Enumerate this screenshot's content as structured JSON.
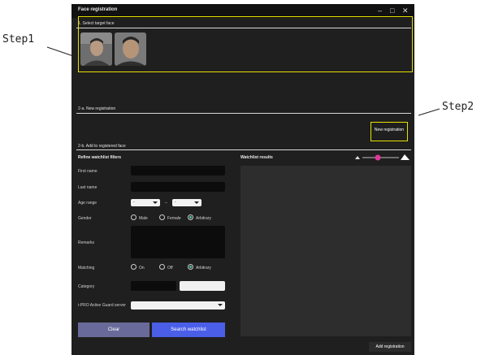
{
  "annotations": {
    "step1": "Step1",
    "step2": "Step2"
  },
  "window": {
    "title": "Face registration",
    "minimize": "–",
    "maximize": "□",
    "close": "✕"
  },
  "sections": {
    "select_target": "1. Select target face",
    "new_registration": "2-a. New registration",
    "add_registered": "2-b. Add to registered face"
  },
  "buttons": {
    "new_registration": "New registration",
    "clear": "Clear",
    "search": "Search watchlist",
    "add_registration": "Add registration"
  },
  "filters": {
    "title": "Refine watchlist filters",
    "first_name": "First name",
    "last_name": "Last name",
    "age_range": "Age range",
    "age_from": "-",
    "age_sep": "–",
    "age_to": "-",
    "gender": "Gender",
    "gender_options": [
      "Male",
      "Female",
      "Arbitrary"
    ],
    "gender_selected": "Arbitrary",
    "remarks": "Remarks",
    "matching": "Matching",
    "matching_options": [
      "On",
      "Off",
      "Arbitrary"
    ],
    "matching_selected": "Arbitrary",
    "category": "Category",
    "server": "i-PRO Active Guard server"
  },
  "results": {
    "title": "Watchlist results",
    "slider_level": 0.45
  },
  "colors": {
    "highlight": "#e8e000",
    "accent": "#4a5ee8",
    "clear_button": "#6a6a9a",
    "slider_thumb": "#e0389a"
  }
}
